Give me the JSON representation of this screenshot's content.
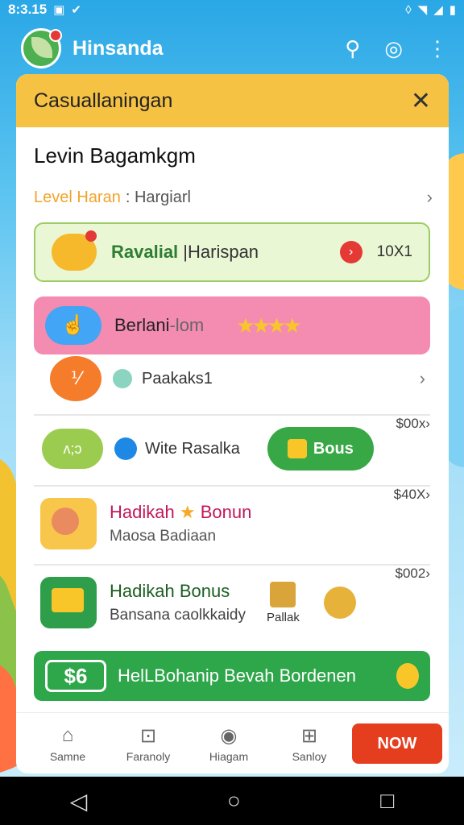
{
  "status": {
    "time": "8:3.15"
  },
  "app": {
    "name": "Hinsanda"
  },
  "card": {
    "title": "Casuallaningan",
    "subtitle": "Levin Bagamkgm",
    "level_label": "Level Haran",
    "level_value": ": Hargiarl"
  },
  "rows": {
    "r1": {
      "title": "Ravalial",
      "rest": " |Harispan",
      "amount": "10X1"
    },
    "r2": {
      "title": "Berlani",
      "rest": "-lom",
      "stars": "★★★★"
    },
    "r3": {
      "title": "Paakaks1"
    },
    "r4": {
      "pill": "ʌ;ɔ",
      "title": "Wite Rasalka",
      "bonus": "Bous",
      "price": "$00x›"
    },
    "r5": {
      "title": "Hadikah",
      "star": "★",
      "title2": "Bonun",
      "subtitle": "Maosa Badiaan",
      "price": "$40X›"
    },
    "r6": {
      "title": "Hadikah Bonus",
      "subtitle": "Bansana caolkkaidy",
      "box_label": "Pallak",
      "price": "$002›"
    },
    "r7": {
      "badge": "$6",
      "text": "HelLBohanip Bevah Bordenen"
    }
  },
  "nav": {
    "items": [
      {
        "label": "Samne",
        "icon": "home-icon"
      },
      {
        "label": "Faranoly",
        "icon": "bag-icon"
      },
      {
        "label": "Hiagam",
        "icon": "game-icon"
      },
      {
        "label": "Sanloy",
        "icon": "grid-icon"
      }
    ],
    "now": "NOW"
  }
}
